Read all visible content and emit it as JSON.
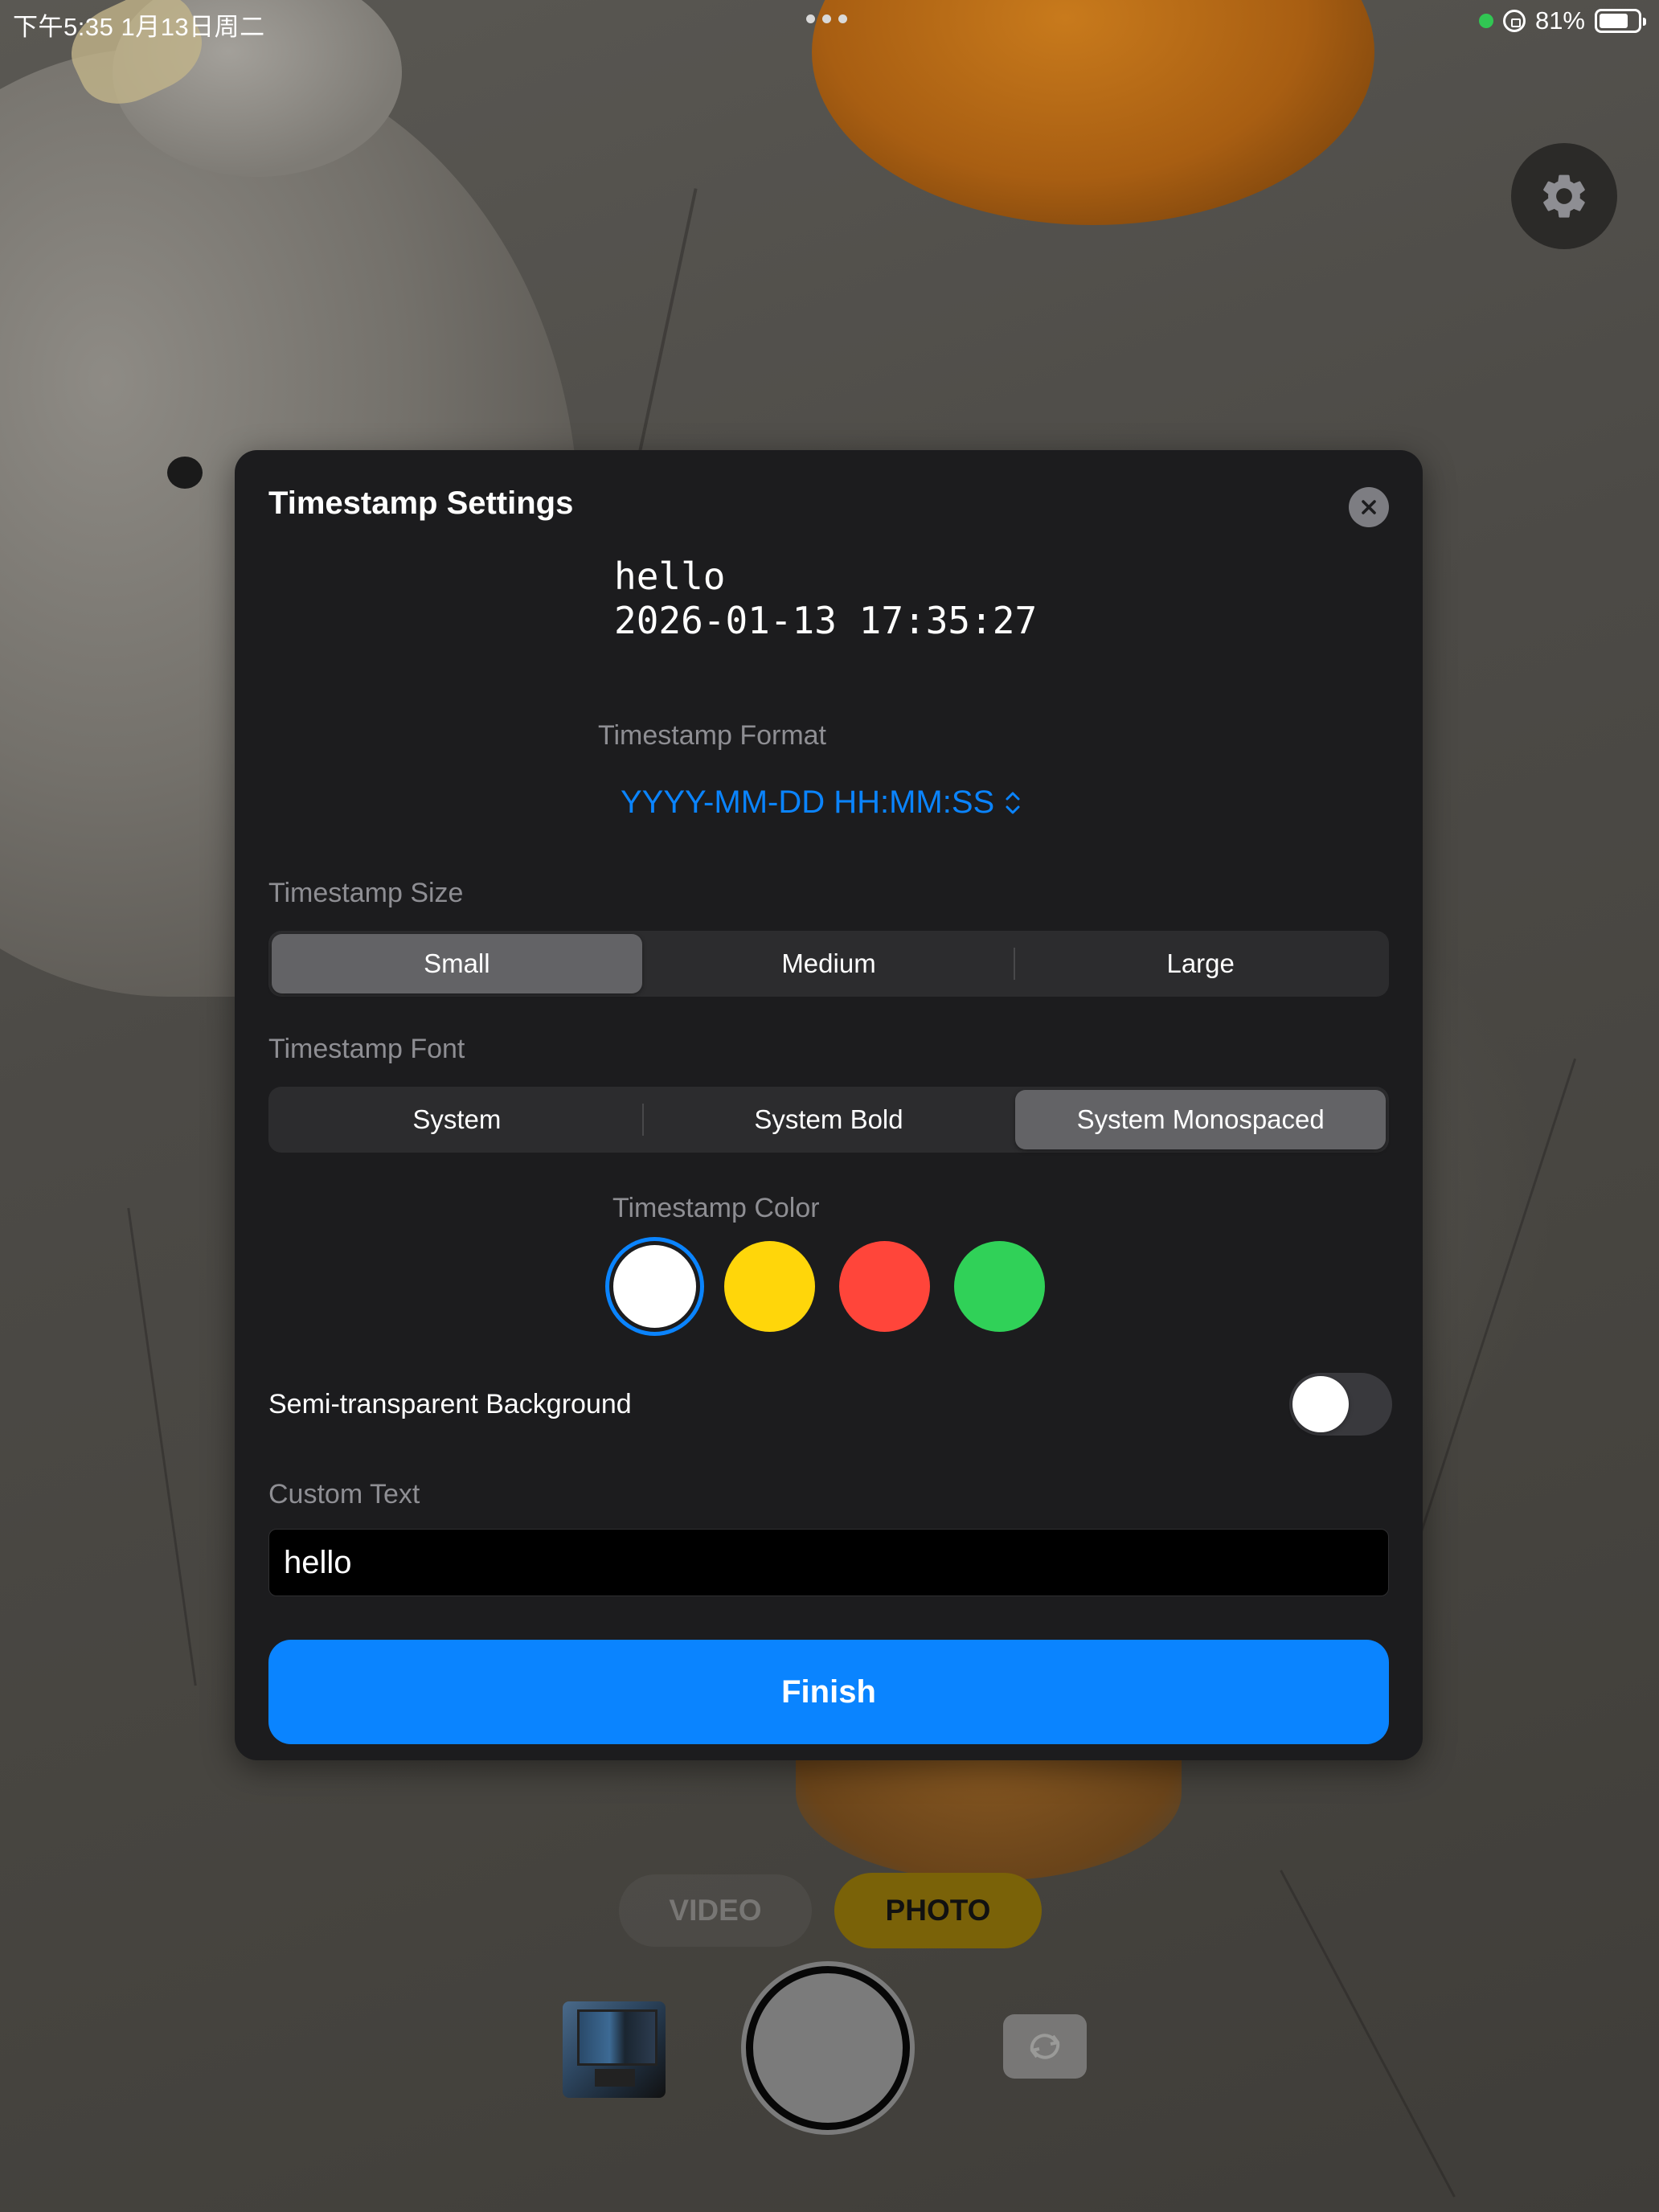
{
  "status_bar": {
    "time_date": "下午5:35   1月13日周二",
    "battery": "81%"
  },
  "modal": {
    "title": "Timestamp Settings",
    "preview_text": "hello\n2026-01-13 17:35:27",
    "format": {
      "label": "Timestamp Format",
      "selected": "YYYY-MM-DD HH:MM:SS"
    },
    "size": {
      "label": "Timestamp Size",
      "options": [
        "Small",
        "Medium",
        "Large"
      ],
      "selected": "Small"
    },
    "font": {
      "label": "Timestamp Font",
      "options": [
        "System",
        "System Bold",
        "System Monospaced"
      ],
      "selected": "System Monospaced"
    },
    "color": {
      "label": "Timestamp Color",
      "swatches": [
        "#ffffff",
        "#ffd60a",
        "#ff453a",
        "#30d158"
      ],
      "selected": "#ffffff"
    },
    "background_toggle": {
      "label": "Semi-transparent Background",
      "on": false
    },
    "custom_text": {
      "label": "Custom Text",
      "value": "hello"
    },
    "finish_label": "Finish"
  },
  "camera": {
    "modes": {
      "video": "VIDEO",
      "photo": "PHOTO"
    },
    "selected_mode": "PHOTO"
  },
  "colors": {
    "accent": "#0a84ff",
    "photo_mode_bg": "#7a6208"
  }
}
